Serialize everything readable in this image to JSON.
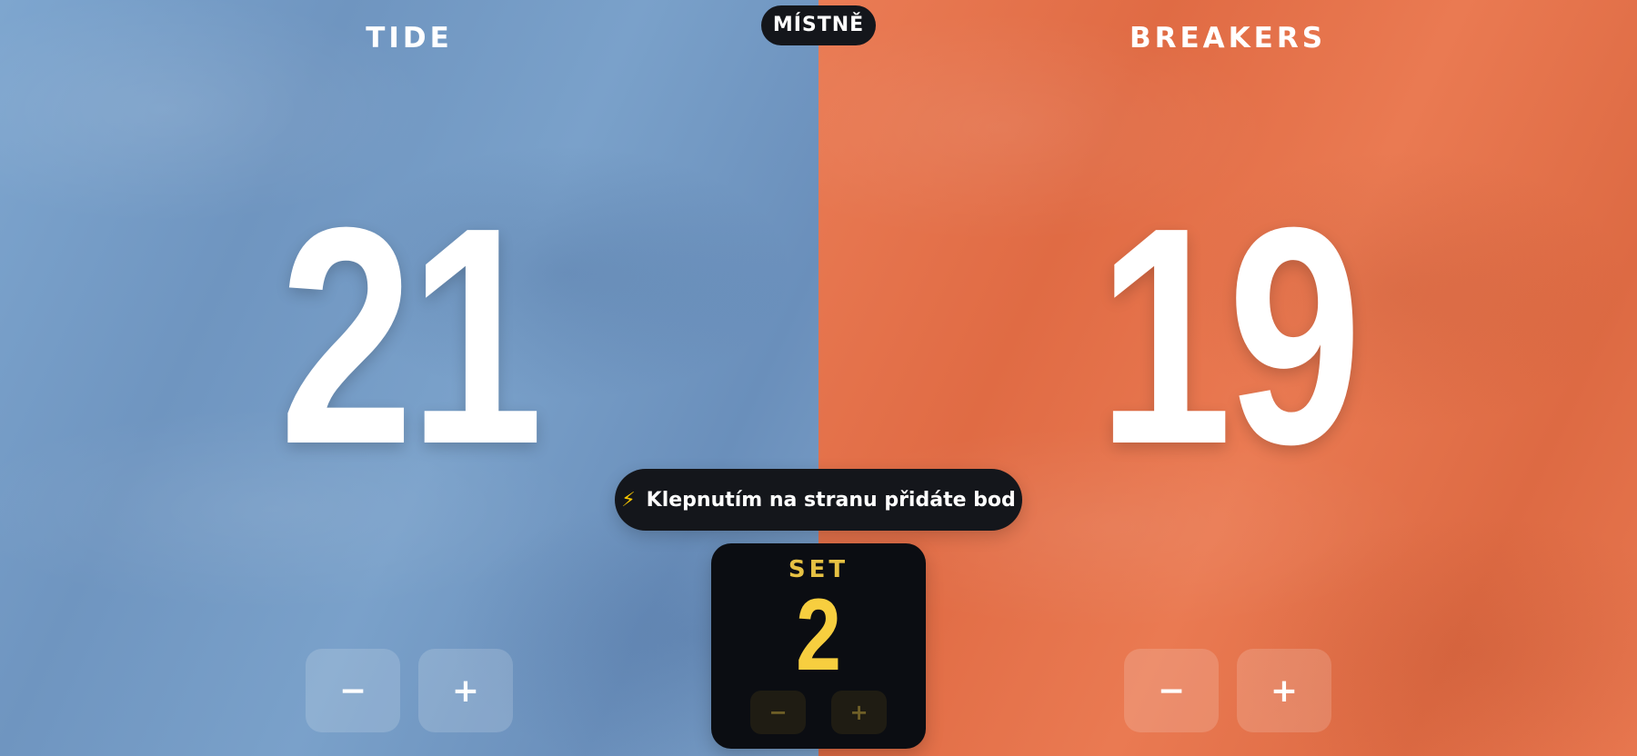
{
  "mode_badge": "MÍSTNĚ",
  "teams": {
    "left": {
      "name": "TIDE",
      "score": "21",
      "color": "#7aa1ca",
      "minus_label": "−",
      "plus_label": "+"
    },
    "right": {
      "name": "BREAKERS",
      "score": "19",
      "color": "#e6744c",
      "minus_label": "−",
      "plus_label": "+"
    }
  },
  "hint": {
    "icon": "⚡",
    "text": "Klepnutím na stranu přidáte bod"
  },
  "set": {
    "label": "SET",
    "value": "2",
    "minus_label": "−",
    "plus_label": "+",
    "accent_color": "#f7ce3f"
  }
}
